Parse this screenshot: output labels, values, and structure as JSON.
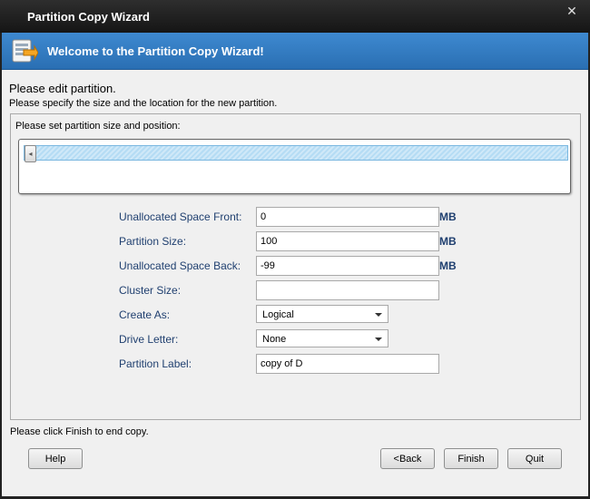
{
  "window": {
    "title": "Partition Copy Wizard",
    "close_glyph": "✕"
  },
  "banner": {
    "title": "Welcome to the Partition Copy Wizard!",
    "icon": "disk-copy-icon"
  },
  "content": {
    "heading": "Please edit partition.",
    "subheading": "Please specify the size and the location for the new partition.",
    "group_label": "Please set partition size and position:",
    "slider_position": 0
  },
  "form": {
    "unallocated_front": {
      "label": "Unallocated Space Front:",
      "value": "0",
      "unit": "MB"
    },
    "partition_size": {
      "label": "Partition Size:",
      "value": "100",
      "unit": "MB"
    },
    "unallocated_back": {
      "label": "Unallocated Space Back:",
      "value": "-99",
      "unit": "MB"
    },
    "cluster_size": {
      "label": "Cluster Size:",
      "value": ""
    },
    "create_as": {
      "label": "Create As:",
      "value": "Logical"
    },
    "drive_letter": {
      "label": "Drive Letter:",
      "value": "None"
    },
    "partition_label": {
      "label": "Partition Label:",
      "value": "copy of D"
    }
  },
  "footer": {
    "instruction": "Please click Finish to end copy.",
    "help": "Help",
    "back": "<Back",
    "finish": "Finish",
    "quit": "Quit"
  },
  "colors": {
    "banner": "#2f7cc4",
    "label": "#1f3f6f",
    "track": "#b5dcf4"
  }
}
